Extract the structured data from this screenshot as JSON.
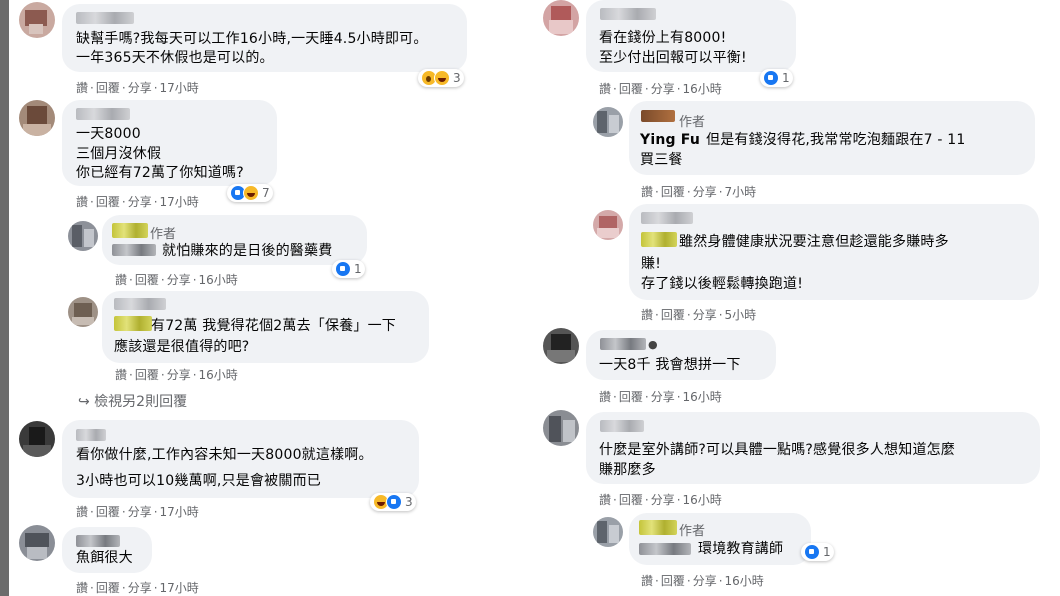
{
  "author_label": "作者",
  "meta_parts": [
    "讚",
    "回覆",
    "分享"
  ],
  "separator": "·",
  "left_column": [
    {
      "lines": [
        "缺幫手嗎?我每天可以工作16小時,一天睡4.5小時即可。",
        "一年365天不休假也是可以的。"
      ],
      "time": "17小時",
      "reaction_count": "3",
      "reaction_icons": [
        "wow-icon",
        "haha-icon"
      ]
    },
    {
      "lines": [
        "一天8000",
        "三個月沒休假",
        "你已經有72萬了你知道嗎?"
      ],
      "time": "17小時",
      "reaction_count": "7",
      "reaction_icons": [
        "like-icon",
        "haha-icon"
      ]
    },
    {
      "lines": [
        "就怕賺來的是日後的醫藥費"
      ],
      "time": "16小時",
      "reaction_count": "1",
      "reaction_icons": [
        "like-icon"
      ],
      "is_author": true
    },
    {
      "lines": [
        "有72萬 我覺得花個2萬去「保養」一下",
        "應該還是很值得的吧?"
      ],
      "time": "16小時"
    },
    {
      "more_replies": "↪ 檢視另2則回覆"
    },
    {
      "lines": [
        "看你做什麼,工作內容未知一天8000就這樣啊。",
        "3小時也可以10幾萬啊,只是會被關而已"
      ],
      "time": "17小時",
      "reaction_count": "3",
      "reaction_icons": [
        "haha-icon",
        "like-icon"
      ]
    },
    {
      "lines": [
        "魚餌很大"
      ],
      "time": "17小時"
    }
  ],
  "right_column": [
    {
      "lines": [
        "看在錢份上有8000!",
        "至少付出回報可以平衡!"
      ],
      "time": "16小時",
      "reaction_count": "1",
      "reaction_icons": [
        "like-icon"
      ]
    },
    {
      "author_name": "Ying Fu",
      "lines": [
        "但是有錢沒得花,我常常吃泡麵跟在7 - 11",
        "買三餐"
      ],
      "time": "7小時",
      "is_author": true
    },
    {
      "lines": [
        "雖然身體健康狀況要注意但趁還能多賺時多",
        "賺!",
        "存了錢以後輕鬆轉換跑道!"
      ],
      "time": "5小時"
    },
    {
      "lines": [
        "一天8千 我會想拼一下"
      ],
      "time": "16小時"
    },
    {
      "lines": [
        "什麼是室外講師?可以具體一點嗎?感覺很多人想知道怎麼",
        "賺那麼多"
      ],
      "time": "16小時"
    },
    {
      "lines": [
        "環境教育講師"
      ],
      "time": "16小時",
      "reaction_count": "1",
      "reaction_icons": [
        "like-icon"
      ],
      "is_author": true
    }
  ]
}
